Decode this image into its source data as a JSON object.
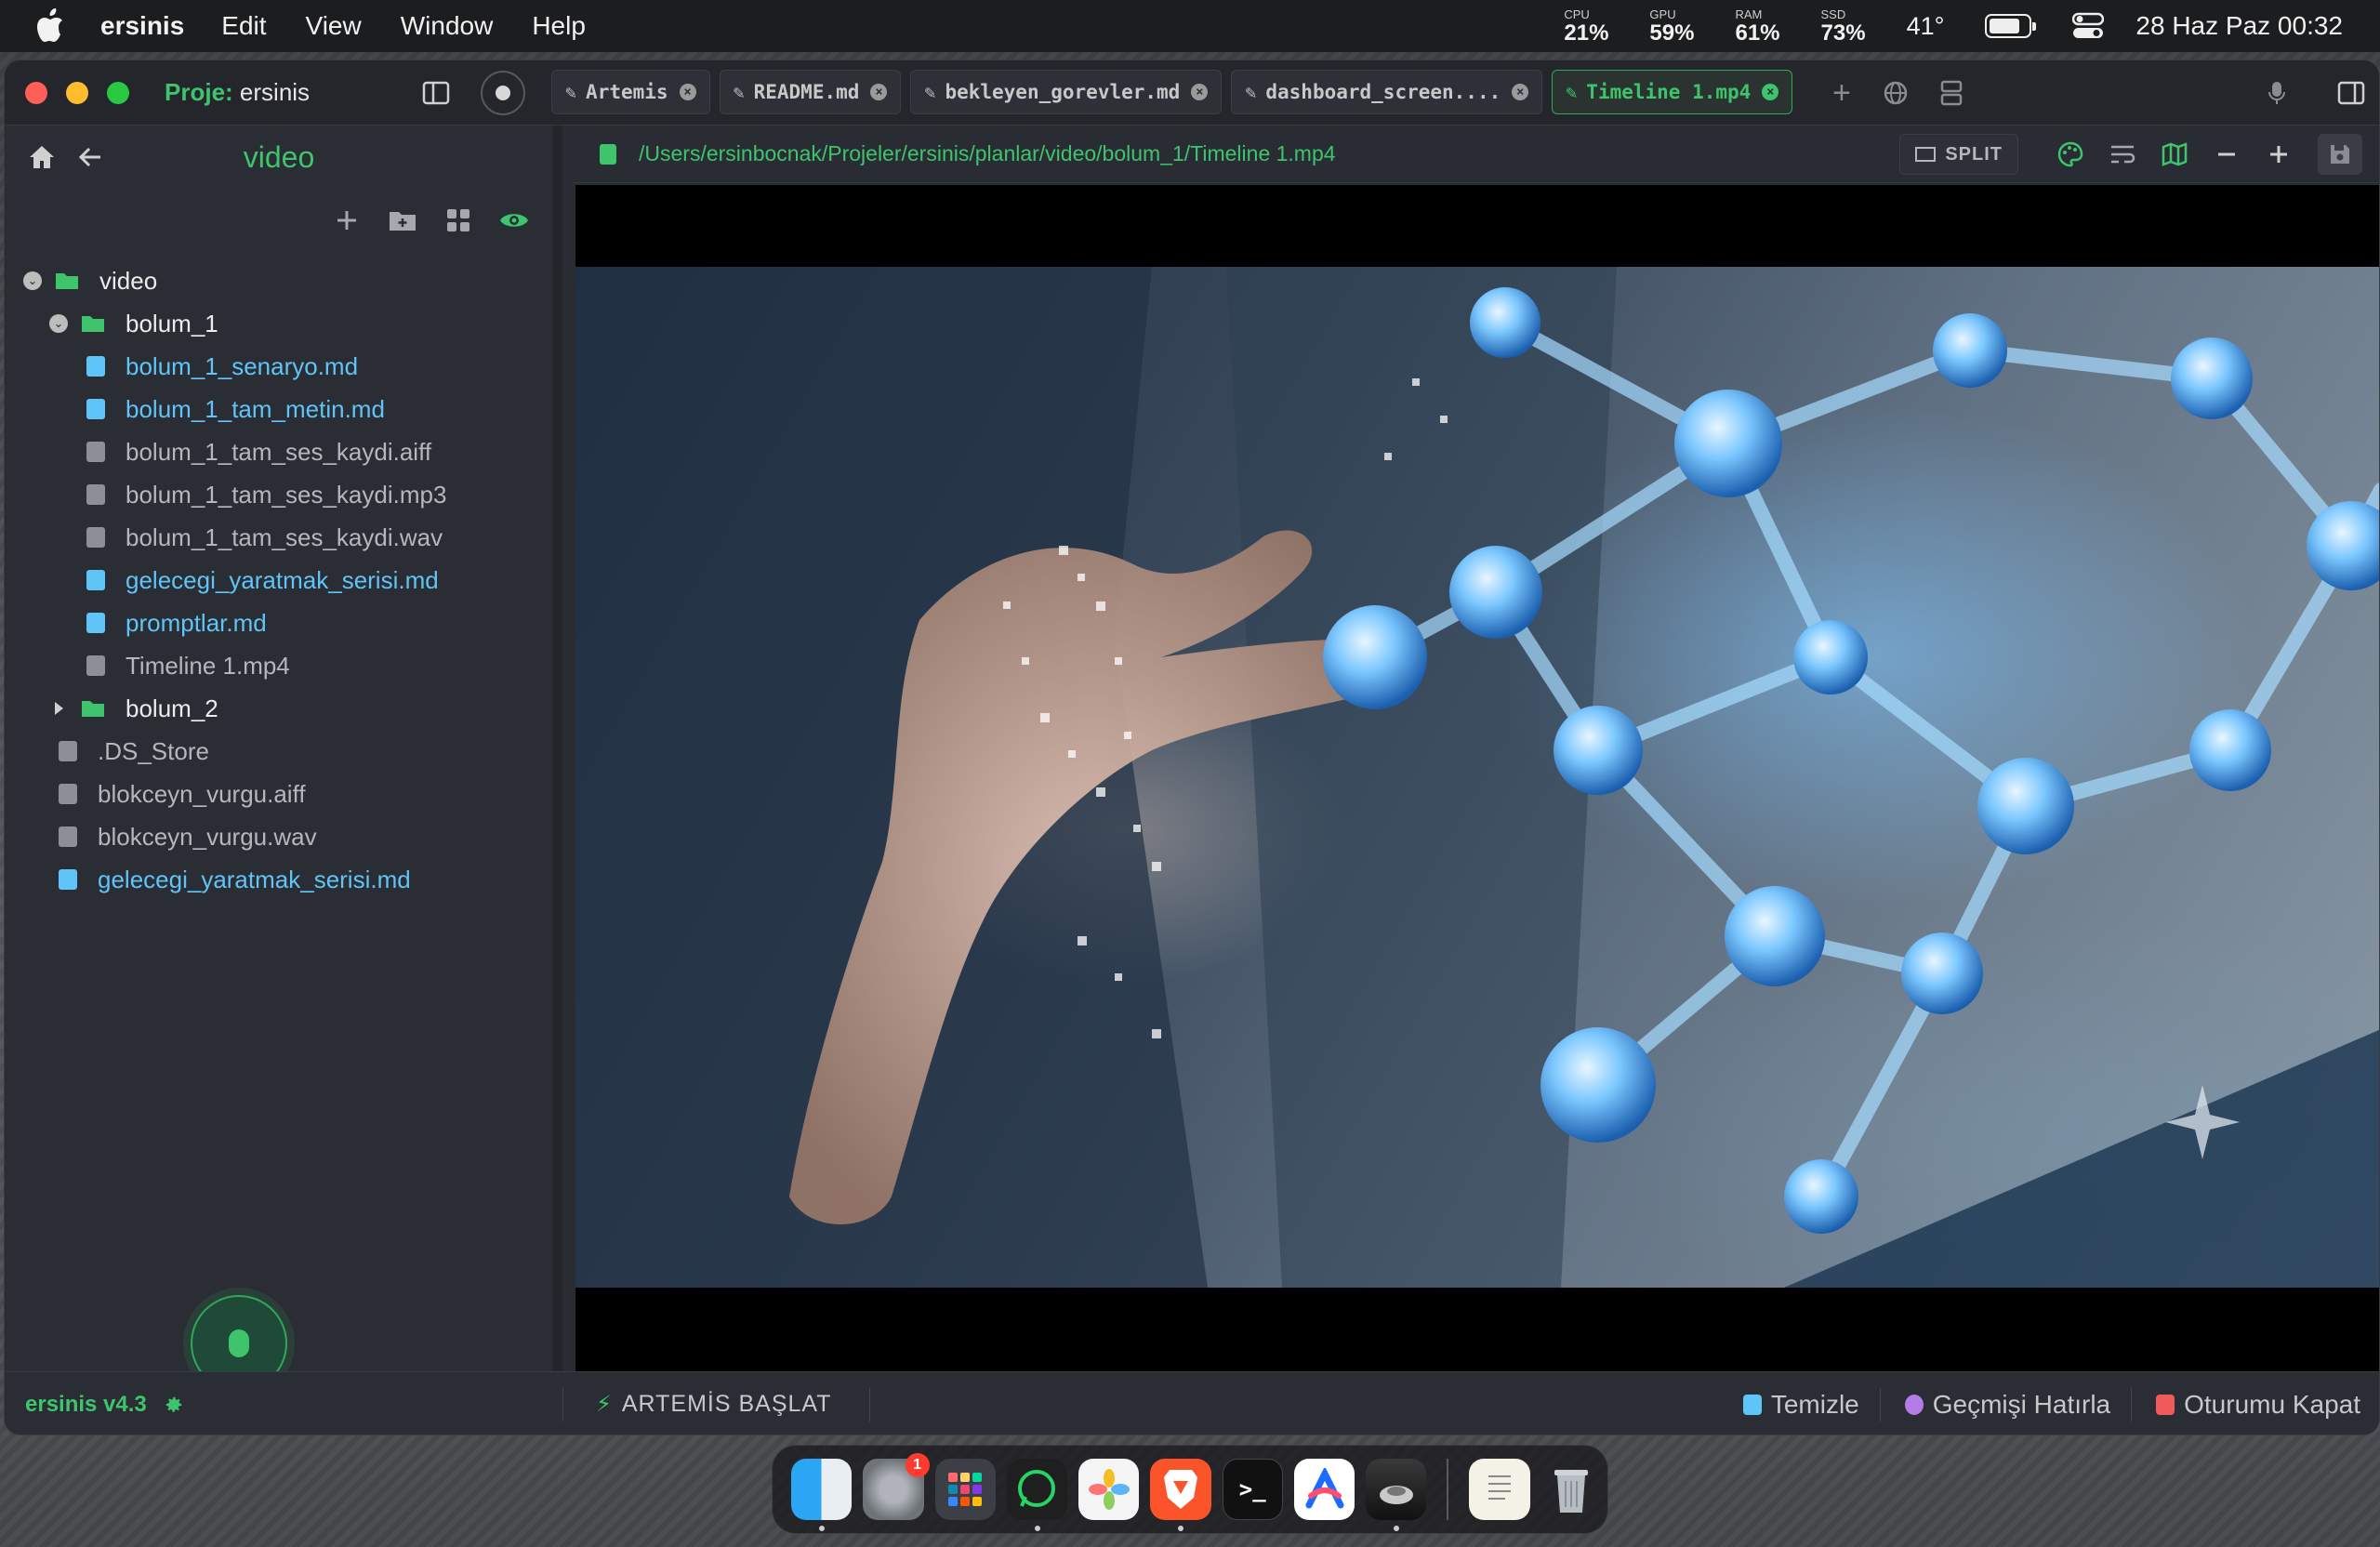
{
  "menubar": {
    "app_name": "ersinis",
    "menus": [
      "Edit",
      "View",
      "Window",
      "Help"
    ],
    "stats": [
      {
        "label": "CPU",
        "value": "21%"
      },
      {
        "label": "GPU",
        "value": "59%"
      },
      {
        "label": "RAM",
        "value": "61%"
      },
      {
        "label": "SSD",
        "value": "73%"
      }
    ],
    "temperature": "41°",
    "battery_level": 0.8,
    "clock": "28 Haz Paz  00:32"
  },
  "titlebar": {
    "project_label": "Proje:",
    "project_name": "ersinis",
    "tabs": [
      {
        "label": "Artemis",
        "active": false
      },
      {
        "label": "README.md",
        "active": false
      },
      {
        "label": "bekleyen_gorevler.md",
        "active": false
      },
      {
        "label": "dashboard_screen....",
        "active": false
      },
      {
        "label": "Timeline 1.mp4",
        "active": true
      }
    ],
    "add_tab": "+"
  },
  "sidebar": {
    "title": "video",
    "tree": [
      {
        "name": "video",
        "type": "folder",
        "depth": 0,
        "expanded": true
      },
      {
        "name": "bolum_1",
        "type": "folder",
        "depth": 1,
        "expanded": true
      },
      {
        "name": "bolum_1_senaryo.md",
        "type": "md",
        "depth": 2
      },
      {
        "name": "bolum_1_tam_metin.md",
        "type": "md",
        "depth": 2
      },
      {
        "name": "bolum_1_tam_ses_kaydi.aiff",
        "type": "plain",
        "depth": 2
      },
      {
        "name": "bolum_1_tam_ses_kaydi.mp3",
        "type": "plain",
        "depth": 2
      },
      {
        "name": "bolum_1_tam_ses_kaydi.wav",
        "type": "plain",
        "depth": 2
      },
      {
        "name": "gelecegi_yaratmak_serisi.md",
        "type": "md",
        "depth": 2
      },
      {
        "name": "promptlar.md",
        "type": "md",
        "depth": 2
      },
      {
        "name": "Timeline 1.mp4",
        "type": "plain",
        "depth": 2
      },
      {
        "name": "bolum_2",
        "type": "folder",
        "depth": 1,
        "expanded": false
      },
      {
        "name": ".DS_Store",
        "type": "plain",
        "depth": 1
      },
      {
        "name": "blokceyn_vurgu.aiff",
        "type": "plain",
        "depth": 1
      },
      {
        "name": "blokceyn_vurgu.wav",
        "type": "plain",
        "depth": 1
      },
      {
        "name": "gelecegi_yaratmak_serisi.md",
        "type": "md",
        "depth": 1
      }
    ]
  },
  "main": {
    "path": "/Users/ersinbocnak/Projeler/ersinis/planlar/video/bolum_1/Timeline 1.mp4",
    "split_label": "SPLIT"
  },
  "statusbar": {
    "version": "ersinis v4.3",
    "start_label": "ARTEMİS BAŞLAT",
    "actions": [
      {
        "label": "Temizle",
        "color": "#5fc4f7"
      },
      {
        "label": "Geçmişi Hatırla",
        "color": "#b57be8"
      },
      {
        "label": "Oturumu Kapat",
        "color": "#f05a5a"
      }
    ]
  },
  "dock": {
    "apps": [
      "finder-icon",
      "system-settings-icon",
      "launchpad-icon",
      "whatsapp-icon",
      "photos-icon",
      "brave-icon",
      "terminal-icon",
      "arc-icon",
      "mousecape-icon"
    ],
    "settings_badge": "1",
    "terminal_glyph": ">_"
  },
  "colors": {
    "accent": "#3ec46d",
    "md_file": "#5fc4f7",
    "plain_file": "#8c8f96"
  }
}
